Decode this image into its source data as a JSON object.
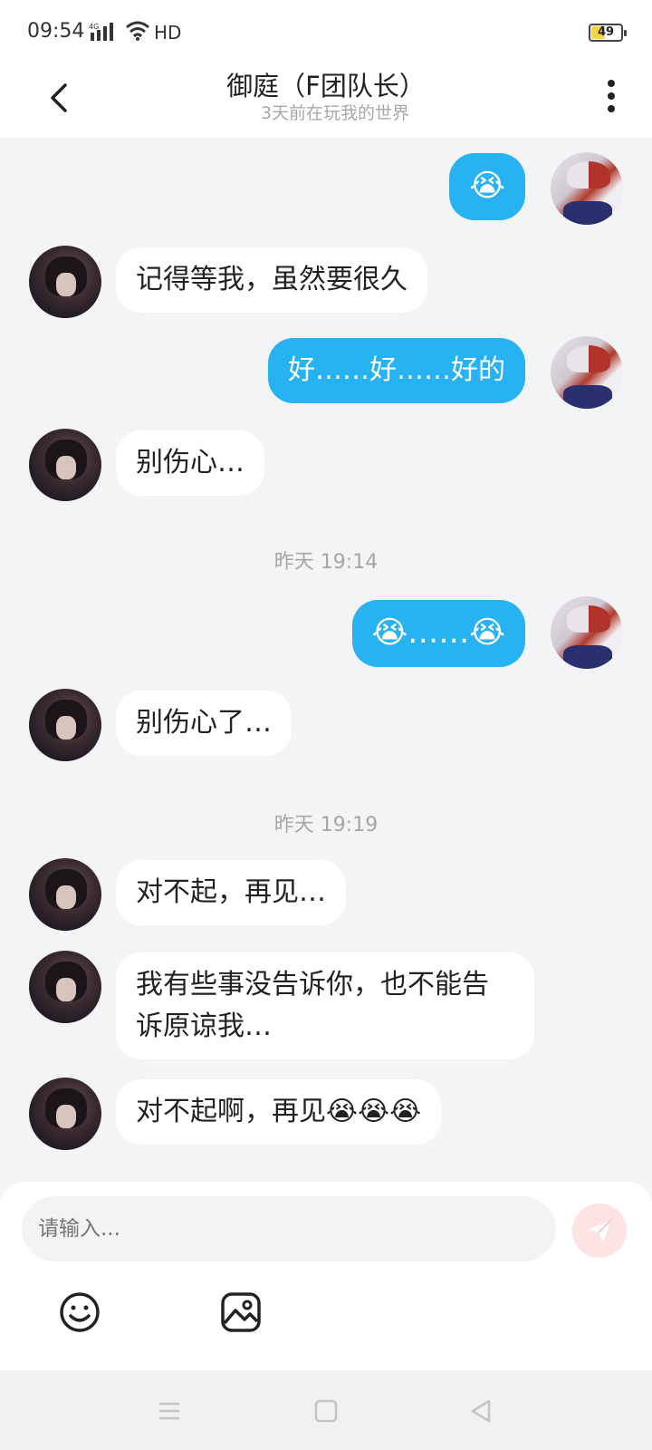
{
  "status_bar": {
    "time": "09:54",
    "network": "HD",
    "battery": "49",
    "colors": {
      "battery_fill": "#f5d540"
    }
  },
  "header": {
    "title": "御庭（F团队长）",
    "subtitle": "3天前在玩我的世界"
  },
  "colors": {
    "outgoing_bubble": "#27b2f1",
    "incoming_bubble": "#ffffff",
    "background": "#f3f4f6",
    "send_button": "#fde3e4"
  },
  "messages": [
    {
      "side": "out",
      "text": "😭"
    },
    {
      "side": "in",
      "text": "记得等我，虽然要很久"
    },
    {
      "side": "out",
      "text": "好……好……好的"
    },
    {
      "side": "in",
      "text": "别伤心…"
    },
    {
      "side": "time",
      "text": "昨天 19:14"
    },
    {
      "side": "out",
      "text": "😭……😭"
    },
    {
      "side": "in",
      "text": "别伤心了…"
    },
    {
      "side": "time",
      "text": "昨天 19:19"
    },
    {
      "side": "in",
      "text": "对不起，再见…"
    },
    {
      "side": "in",
      "text": "我有些事没告诉你，也不能告诉原谅我…"
    },
    {
      "side": "in",
      "text": "对不起啊，再见😭😭😭"
    }
  ],
  "composer": {
    "placeholder": "请输入...",
    "tools": [
      "emoji-icon",
      "image-icon"
    ],
    "send_icon": "send-icon"
  },
  "nav": [
    "menu-icon",
    "home-icon",
    "back-icon"
  ]
}
